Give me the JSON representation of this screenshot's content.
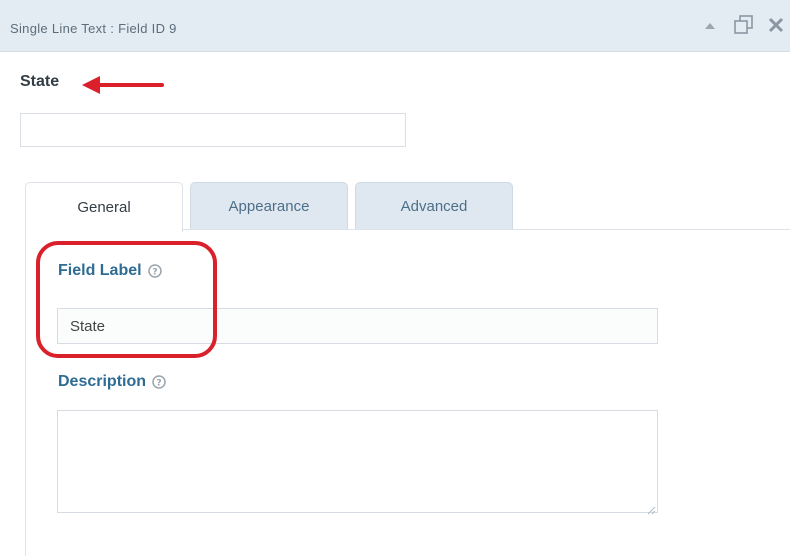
{
  "header": {
    "title": "Single Line Text : Field ID 9"
  },
  "preview": {
    "label": "State",
    "input_value": ""
  },
  "tabs": [
    {
      "label": "General"
    },
    {
      "label": "Appearance"
    },
    {
      "label": "Advanced"
    }
  ],
  "general": {
    "field_label_heading": "Field Label",
    "field_label_value": "State",
    "description_heading": "Description",
    "description_value": ""
  },
  "icons": {
    "collapse": "triangle-up-icon",
    "duplicate": "duplicate-icon",
    "close": "close-icon",
    "help": "help-circle-icon",
    "annotation_arrow": "arrow-left-icon"
  },
  "colors": {
    "header_bg": "#e4ecf3",
    "heading_blue": "#2f6c93",
    "annotation_red": "#d9202b",
    "tab_inactive_bg": "#dfe8f0"
  }
}
